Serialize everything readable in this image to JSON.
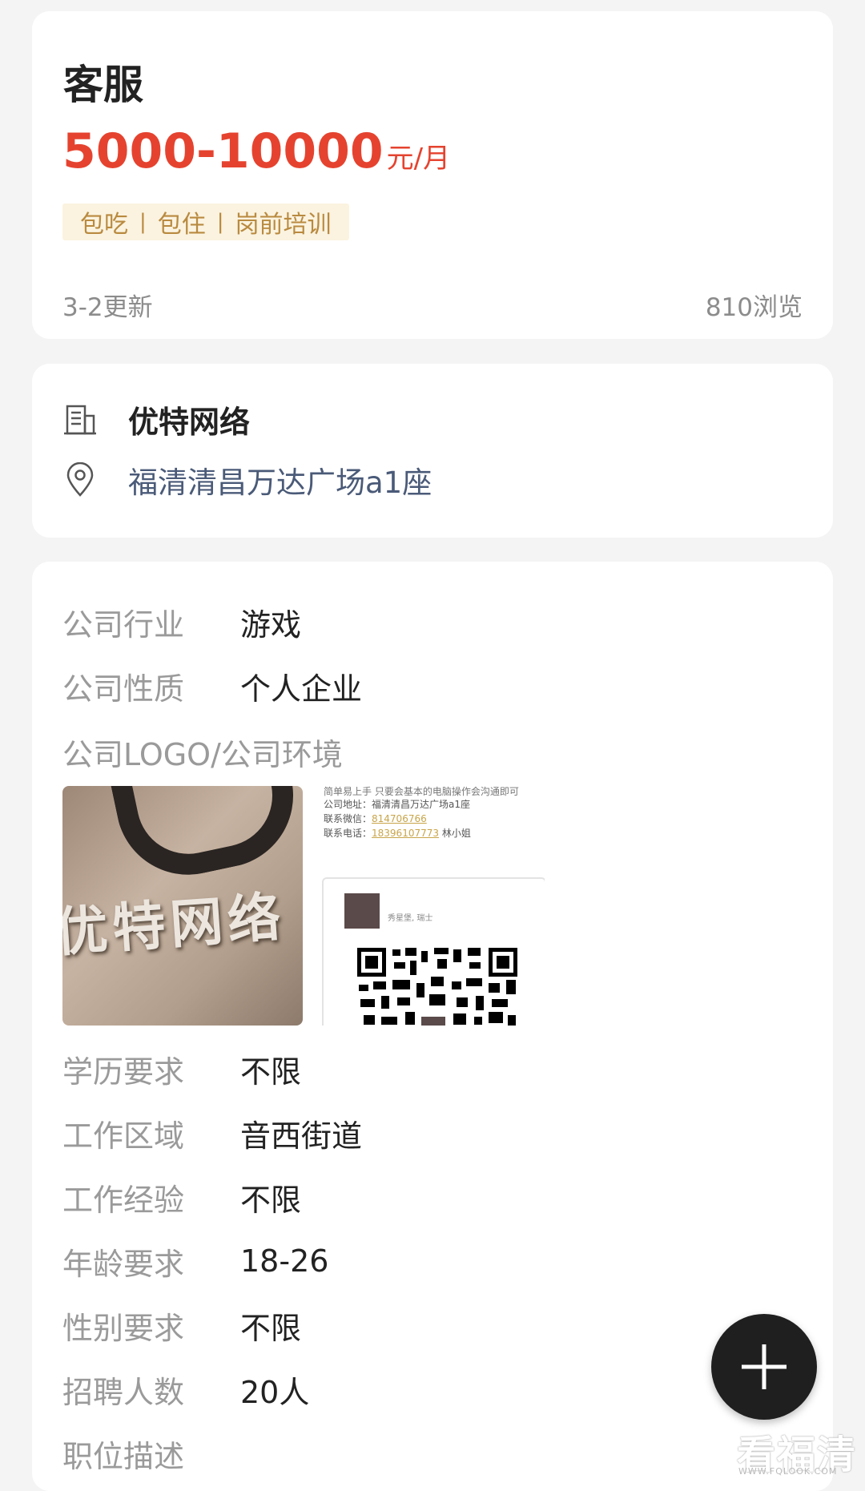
{
  "job": {
    "title": "客服",
    "salary": "5000-10000",
    "salary_unit": "元/月",
    "tags": [
      "包吃",
      "包住",
      "岗前培训"
    ],
    "tag_separator": "|",
    "updated": "3-2更新",
    "views": "810浏览"
  },
  "company": {
    "name": "优特网络",
    "address": "福清清昌万达广场a1座",
    "icons": [
      "building-icon",
      "location-pin-icon"
    ]
  },
  "details": {
    "industry_label": "公司行业",
    "industry": "游戏",
    "nature_label": "公司性质",
    "nature": "个人企业",
    "gallery_label": "公司LOGO/公司环境",
    "education_label": "学历要求",
    "education": "不限",
    "area_label": "工作区域",
    "area": "音西街道",
    "experience_label": "工作经验",
    "experience": "不限",
    "age_label": "年龄要求",
    "age": "18-26",
    "gender_label": "性别要求",
    "gender": "不限",
    "headcount_label": "招聘人数",
    "headcount": "20人",
    "description_label": "职位描述"
  },
  "gallery": {
    "photo1_sign": "优特网络",
    "photo2": {
      "line0": "简单易上手 只要会基本的电脑操作会沟通即可",
      "address_line": "公司地址：福清清昌万达广场a1座",
      "wechat_label": "联系微信：",
      "wechat": "814706766",
      "phone_label": "联系电话：",
      "phone": "18396107773",
      "contact": "林小姐",
      "qr_name": "秀星堡, 瑞士"
    }
  },
  "fab": {
    "icon": "plus-icon"
  },
  "watermark": {
    "text": "看福清",
    "sub": "WWW.FQLOOK.COM"
  },
  "colors": {
    "accent": "#e5432f",
    "tag_text": "#b98a3f",
    "tag_bg": "#fbf3e0",
    "address": "#4a5a78",
    "fab": "#1f1f1f"
  }
}
